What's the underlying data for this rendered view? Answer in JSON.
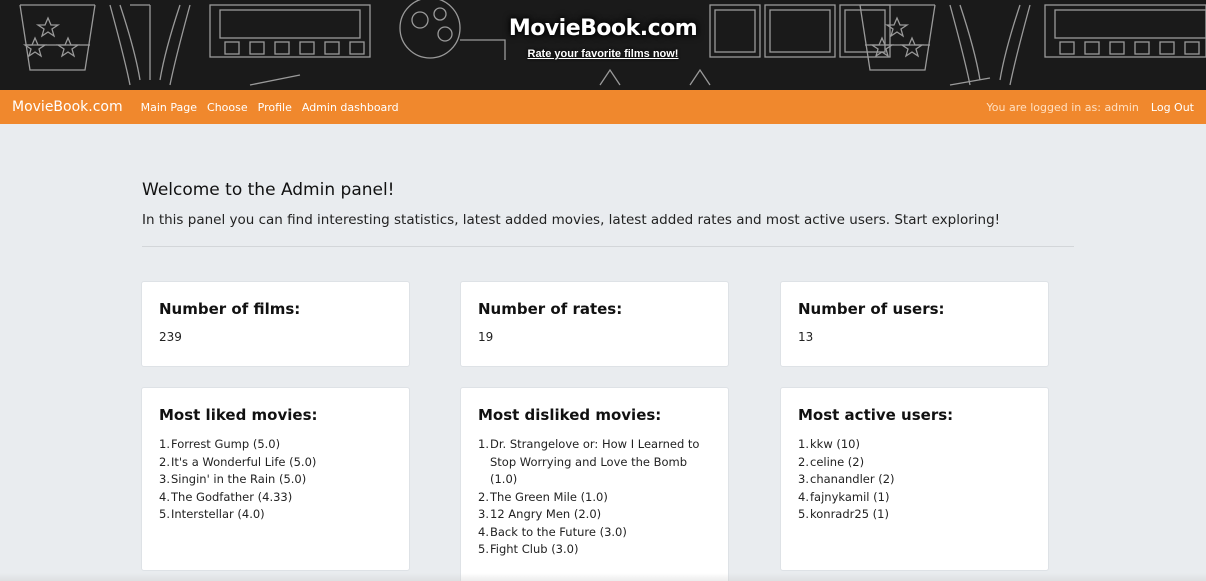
{
  "banner": {
    "title": "MovieBook.com",
    "subtitle": "Rate your favorite films now!"
  },
  "navbar": {
    "brand": "MovieBook.com",
    "links": [
      "Main Page",
      "Choose",
      "Profile",
      "Admin dashboard"
    ],
    "logged_in_text": "You are logged in as: admin",
    "logout_label": "Log Out",
    "color": "#f0882d"
  },
  "main": {
    "title": "Welcome to the Admin panel!",
    "lead": "In this panel you can find interesting statistics, latest added movies, latest added rates and most active users. Start exploring!"
  },
  "stats": [
    {
      "title": "Number of films:",
      "value": "239"
    },
    {
      "title": "Number of rates:",
      "value": "19"
    },
    {
      "title": "Number of users:",
      "value": "13"
    }
  ],
  "lists": [
    {
      "title": "Most liked movies:",
      "items": [
        "Forrest Gump (5.0)",
        "It's a Wonderful Life (5.0)",
        "Singin' in the Rain (5.0)",
        "The Godfather (4.33)",
        "Interstellar (4.0)"
      ]
    },
    {
      "title": "Most disliked movies:",
      "items": [
        "Dr. Strangelove or: How I Learned to Stop Worrying and Love the Bomb (1.0)",
        "The Green Mile (1.0)",
        "12 Angry Men (2.0)",
        "Back to the Future (3.0)",
        "Fight Club (3.0)"
      ]
    },
    {
      "title": "Most active users:",
      "items": [
        "kkw (10)",
        "celine (2)",
        "chanandler (2)",
        "fajnykamil (1)",
        "konradr25 (1)"
      ]
    }
  ]
}
